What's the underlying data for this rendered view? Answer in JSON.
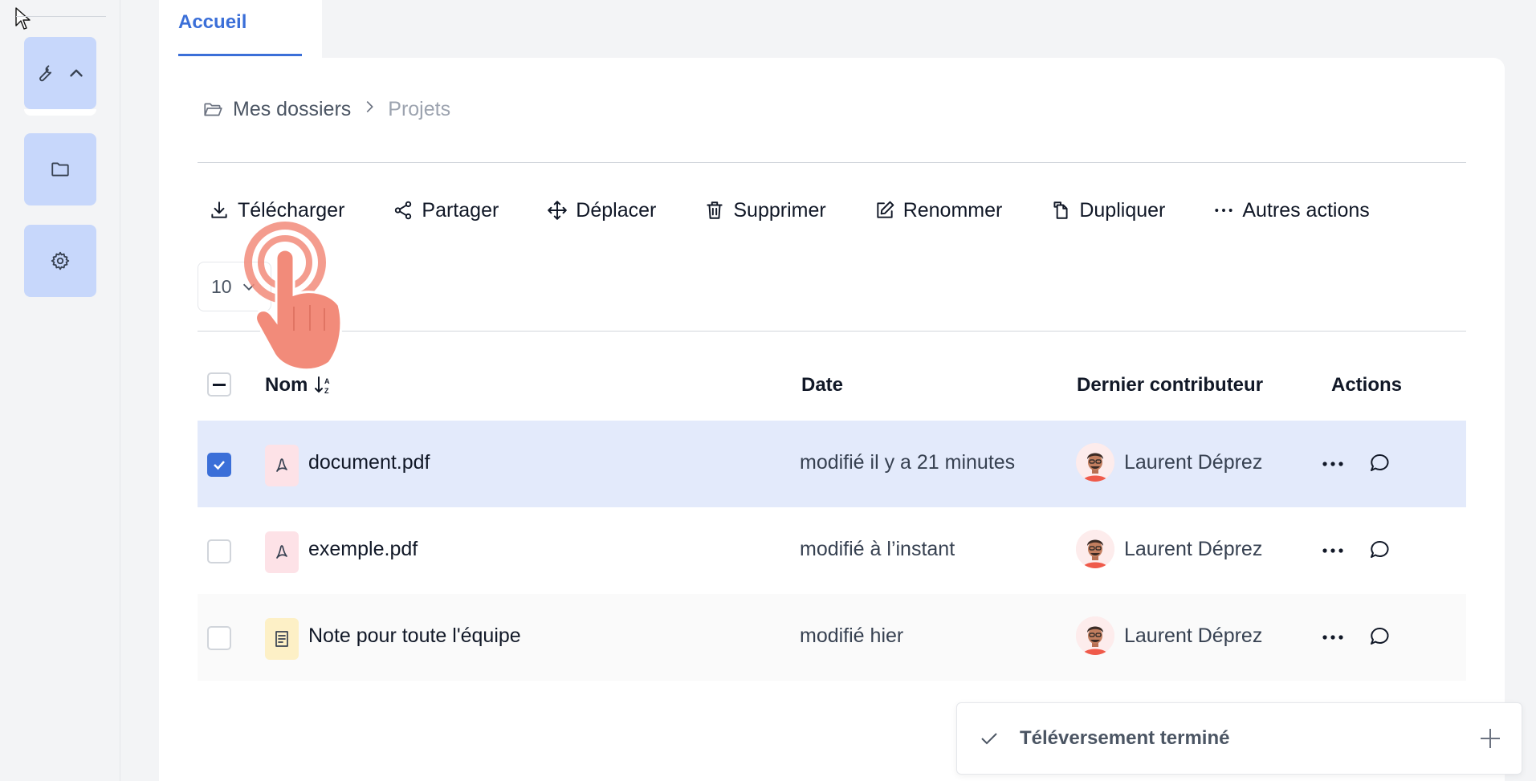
{
  "tab": {
    "label": "Accueil"
  },
  "breadcrumb": {
    "root": "Mes dossiers",
    "current": "Projets"
  },
  "toolbar": {
    "download": "Télécharger",
    "share": "Partager",
    "move": "Déplacer",
    "delete": "Supprimer",
    "rename": "Renommer",
    "duplicate": "Dupliquer",
    "more": "Autres actions"
  },
  "pagination": {
    "page_size": "10"
  },
  "table": {
    "headers": {
      "name": "Nom",
      "date": "Date",
      "contributor": "Dernier contributeur",
      "actions": "Actions"
    },
    "rows": [
      {
        "name": "document.pdf",
        "date": "modifié il y a 21 minutes",
        "contributor": "Laurent Déprez",
        "type": "pdf",
        "selected": true
      },
      {
        "name": "exemple.pdf",
        "date": "modifié à l’instant",
        "contributor": "Laurent Déprez",
        "type": "pdf",
        "selected": false
      },
      {
        "name": "Note pour toute l'équipe",
        "date": "modifié hier",
        "contributor": "Laurent Déprez",
        "type": "note",
        "selected": false
      }
    ]
  },
  "toast": {
    "message": "Téléversement terminé"
  },
  "colors": {
    "accent": "#3b6fd8",
    "rail_button": "#c7d7fb",
    "selected_row": "#e3eafb",
    "tap_overlay": "#f28b7a"
  }
}
